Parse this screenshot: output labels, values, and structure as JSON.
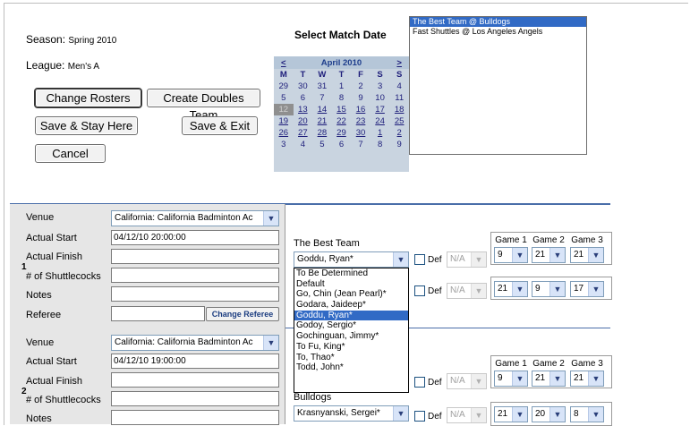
{
  "season": {
    "label": "Season:",
    "value": "Spring 2010"
  },
  "league": {
    "label": "League:",
    "value": "Men's A"
  },
  "buttons": {
    "change_rosters": "Change Rosters",
    "create_doubles": "Create Doubles Team",
    "save_stay": "Save & Stay Here",
    "save_exit": "Save & Exit",
    "cancel": "Cancel",
    "change_referee": "Change Referee"
  },
  "calendar": {
    "title": "Select Match Date",
    "prev": "<",
    "next": ">",
    "month": "April 2010",
    "dow": [
      "M",
      "T",
      "W",
      "T",
      "F",
      "S",
      "S"
    ],
    "weeks": [
      [
        "29",
        "30",
        "31",
        "1",
        "2",
        "3",
        "4"
      ],
      [
        "5",
        "6",
        "7",
        "8",
        "9",
        "10",
        "11"
      ],
      [
        "12",
        "13",
        "14",
        "15",
        "16",
        "17",
        "18"
      ],
      [
        "19",
        "20",
        "21",
        "22",
        "23",
        "24",
        "25"
      ],
      [
        "26",
        "27",
        "28",
        "29",
        "30",
        "1",
        "2"
      ],
      [
        "3",
        "4",
        "5",
        "6",
        "7",
        "8",
        "9"
      ]
    ],
    "selected_day": "12"
  },
  "matches": [
    "The Best Team @ Bulldogs",
    "Fast Shuttles @ Los Angeles Angels"
  ],
  "selected_match": 0,
  "labels": {
    "venue": "Venue",
    "actual_start": "Actual Start",
    "actual_finish": "Actual Finish",
    "shuttlecocks": "# of Shuttlecocks",
    "notes": "Notes",
    "referee": "Referee",
    "def": "Def",
    "game1": "Game 1",
    "game2": "Game 2",
    "game3": "Game 3"
  },
  "matches_detail": [
    {
      "index": "1",
      "venue": "California: California Badminton Ac",
      "actual_start": "04/12/10 20:00:00",
      "team1": "The Best Team",
      "player1": "Goddu, Ryan*",
      "forfeit1": "N/A",
      "scores1": [
        "9",
        "21",
        "21"
      ],
      "forfeit2": "N/A",
      "scores2": [
        "21",
        "9",
        "17"
      ]
    },
    {
      "index": "2",
      "venue": "California: California Badminton Ac",
      "actual_start": "04/12/10 19:00:00",
      "team2": "Bulldogs",
      "player2": "Krasnyanski, Sergei*",
      "forfeit1": "N/A",
      "scores1": [
        "9",
        "21",
        "21"
      ],
      "forfeit2": "N/A",
      "scores2": [
        "21",
        "20",
        "8"
      ]
    }
  ],
  "player_dropdown": {
    "options": [
      "To Be Determined",
      "Default",
      "Go, Chin (Jean Pearl)*",
      "Godara, Jaideep*",
      "Goddu, Ryan*",
      "Godoy, Sergio*",
      "Gochinguan, Jimmy*",
      "To Fu, King*",
      "To, Thao*",
      "Todd, John*"
    ],
    "highlighted": 4
  },
  "colors": {
    "accent": "#316ac5",
    "rule": "#4a6ea9",
    "panel": "#e6e6e6",
    "calendar": "#c9d4e0"
  }
}
